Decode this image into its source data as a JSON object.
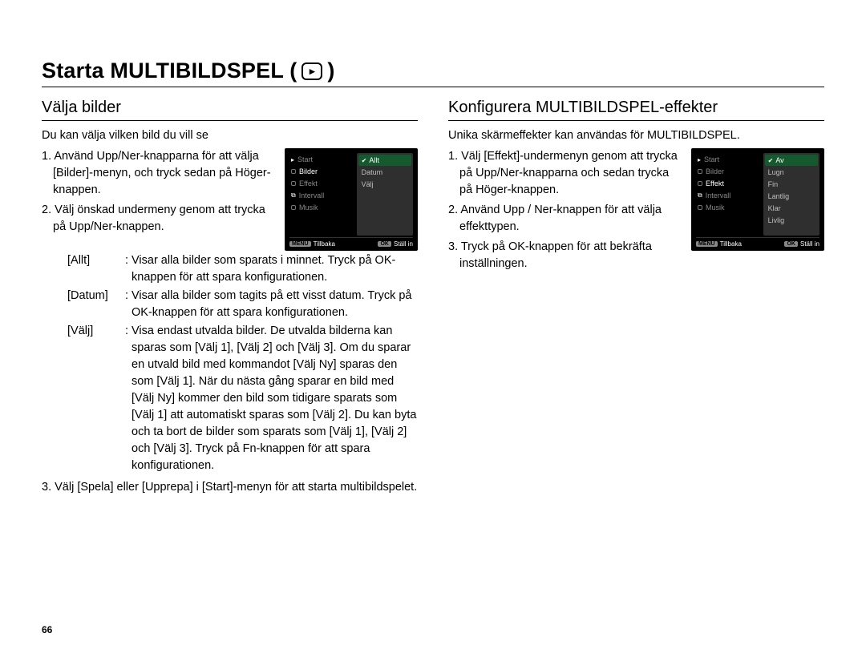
{
  "pageNumber": "66",
  "title": {
    "prefix": "Starta MULTIBILDSPEL (",
    "suffix": " )",
    "icon_symbol": "▸"
  },
  "left": {
    "heading": "Välja bilder",
    "lead": "Du kan välja vilken bild du vill se",
    "step1": "1. Använd Upp/Ner-knapparna för att välja [Bilder]-menyn, och tryck sedan på Höger-knappen.",
    "step2": "2. Välj önskad undermeny genom att trycka på Upp/Ner-knappen.",
    "def": {
      "k1": "[Allt]",
      "v1": "Visar alla bilder som sparats i minnet. Tryck på OK-knappen för att spara konfigurationen.",
      "k2": "[Datum]",
      "v2": "Visar alla bilder som tagits på ett visst datum. Tryck på OK-knappen för att spara konfigurationen.",
      "k3": "[Välj]",
      "v3": "Visa endast utvalda bilder. De utvalda bilderna kan sparas som [Välj 1], [Välj 2] och [Välj 3]. Om du sparar en utvald bild med kommandot [Välj Ny] sparas den som [Välj 1]. När du nästa gång sparar en bild med [Välj Ny] kommer den bild som tidigare sparats som [Välj 1] att automatiskt sparas som [Välj 2]. Du kan byta och ta bort de bilder som sparats som [Välj 1], [Välj 2] och [Välj 3]. Tryck på Fn-knappen för att spara konfigurationen."
    },
    "step3": "3. Välj [Spela] eller [Upprepa] i [Start]-menyn för att starta multibildspelet.",
    "screen": {
      "menu": [
        "Start",
        "Bilder",
        "Effekt",
        "Intervall",
        "Musik"
      ],
      "selectedMenu": "Bilder",
      "sub": [
        "Allt",
        "Datum",
        "Välj"
      ],
      "selectedSub": "Allt",
      "footerLeftBadge": "MENU",
      "footerLeft": "Tillbaka",
      "footerRightBadge": "OK",
      "footerRight": "Ställ in"
    }
  },
  "right": {
    "heading": "Konfigurera MULTIBILDSPEL-effekter",
    "lead": "Unika skärmeffekter kan användas för MULTIBILDSPEL.",
    "step1": "1. Välj [Effekt]-undermenyn genom att trycka på Upp/Ner-knapparna och sedan trycka på Höger-knappen.",
    "step2": "2. Använd Upp / Ner-knappen för att välja effekttypen.",
    "step3": "3. Tryck på OK-knappen för att bekräfta inställningen.",
    "screen": {
      "menu": [
        "Start",
        "Bilder",
        "Effekt",
        "Intervall",
        "Musik"
      ],
      "selectedMenu": "Effekt",
      "sub": [
        "Av",
        "Lugn",
        "Fin",
        "Lantlig",
        "Klar",
        "Livlig"
      ],
      "selectedSub": "Av",
      "footerLeftBadge": "MENU",
      "footerLeft": "Tillbaka",
      "footerRightBadge": "OK",
      "footerRight": "Ställ in"
    }
  }
}
